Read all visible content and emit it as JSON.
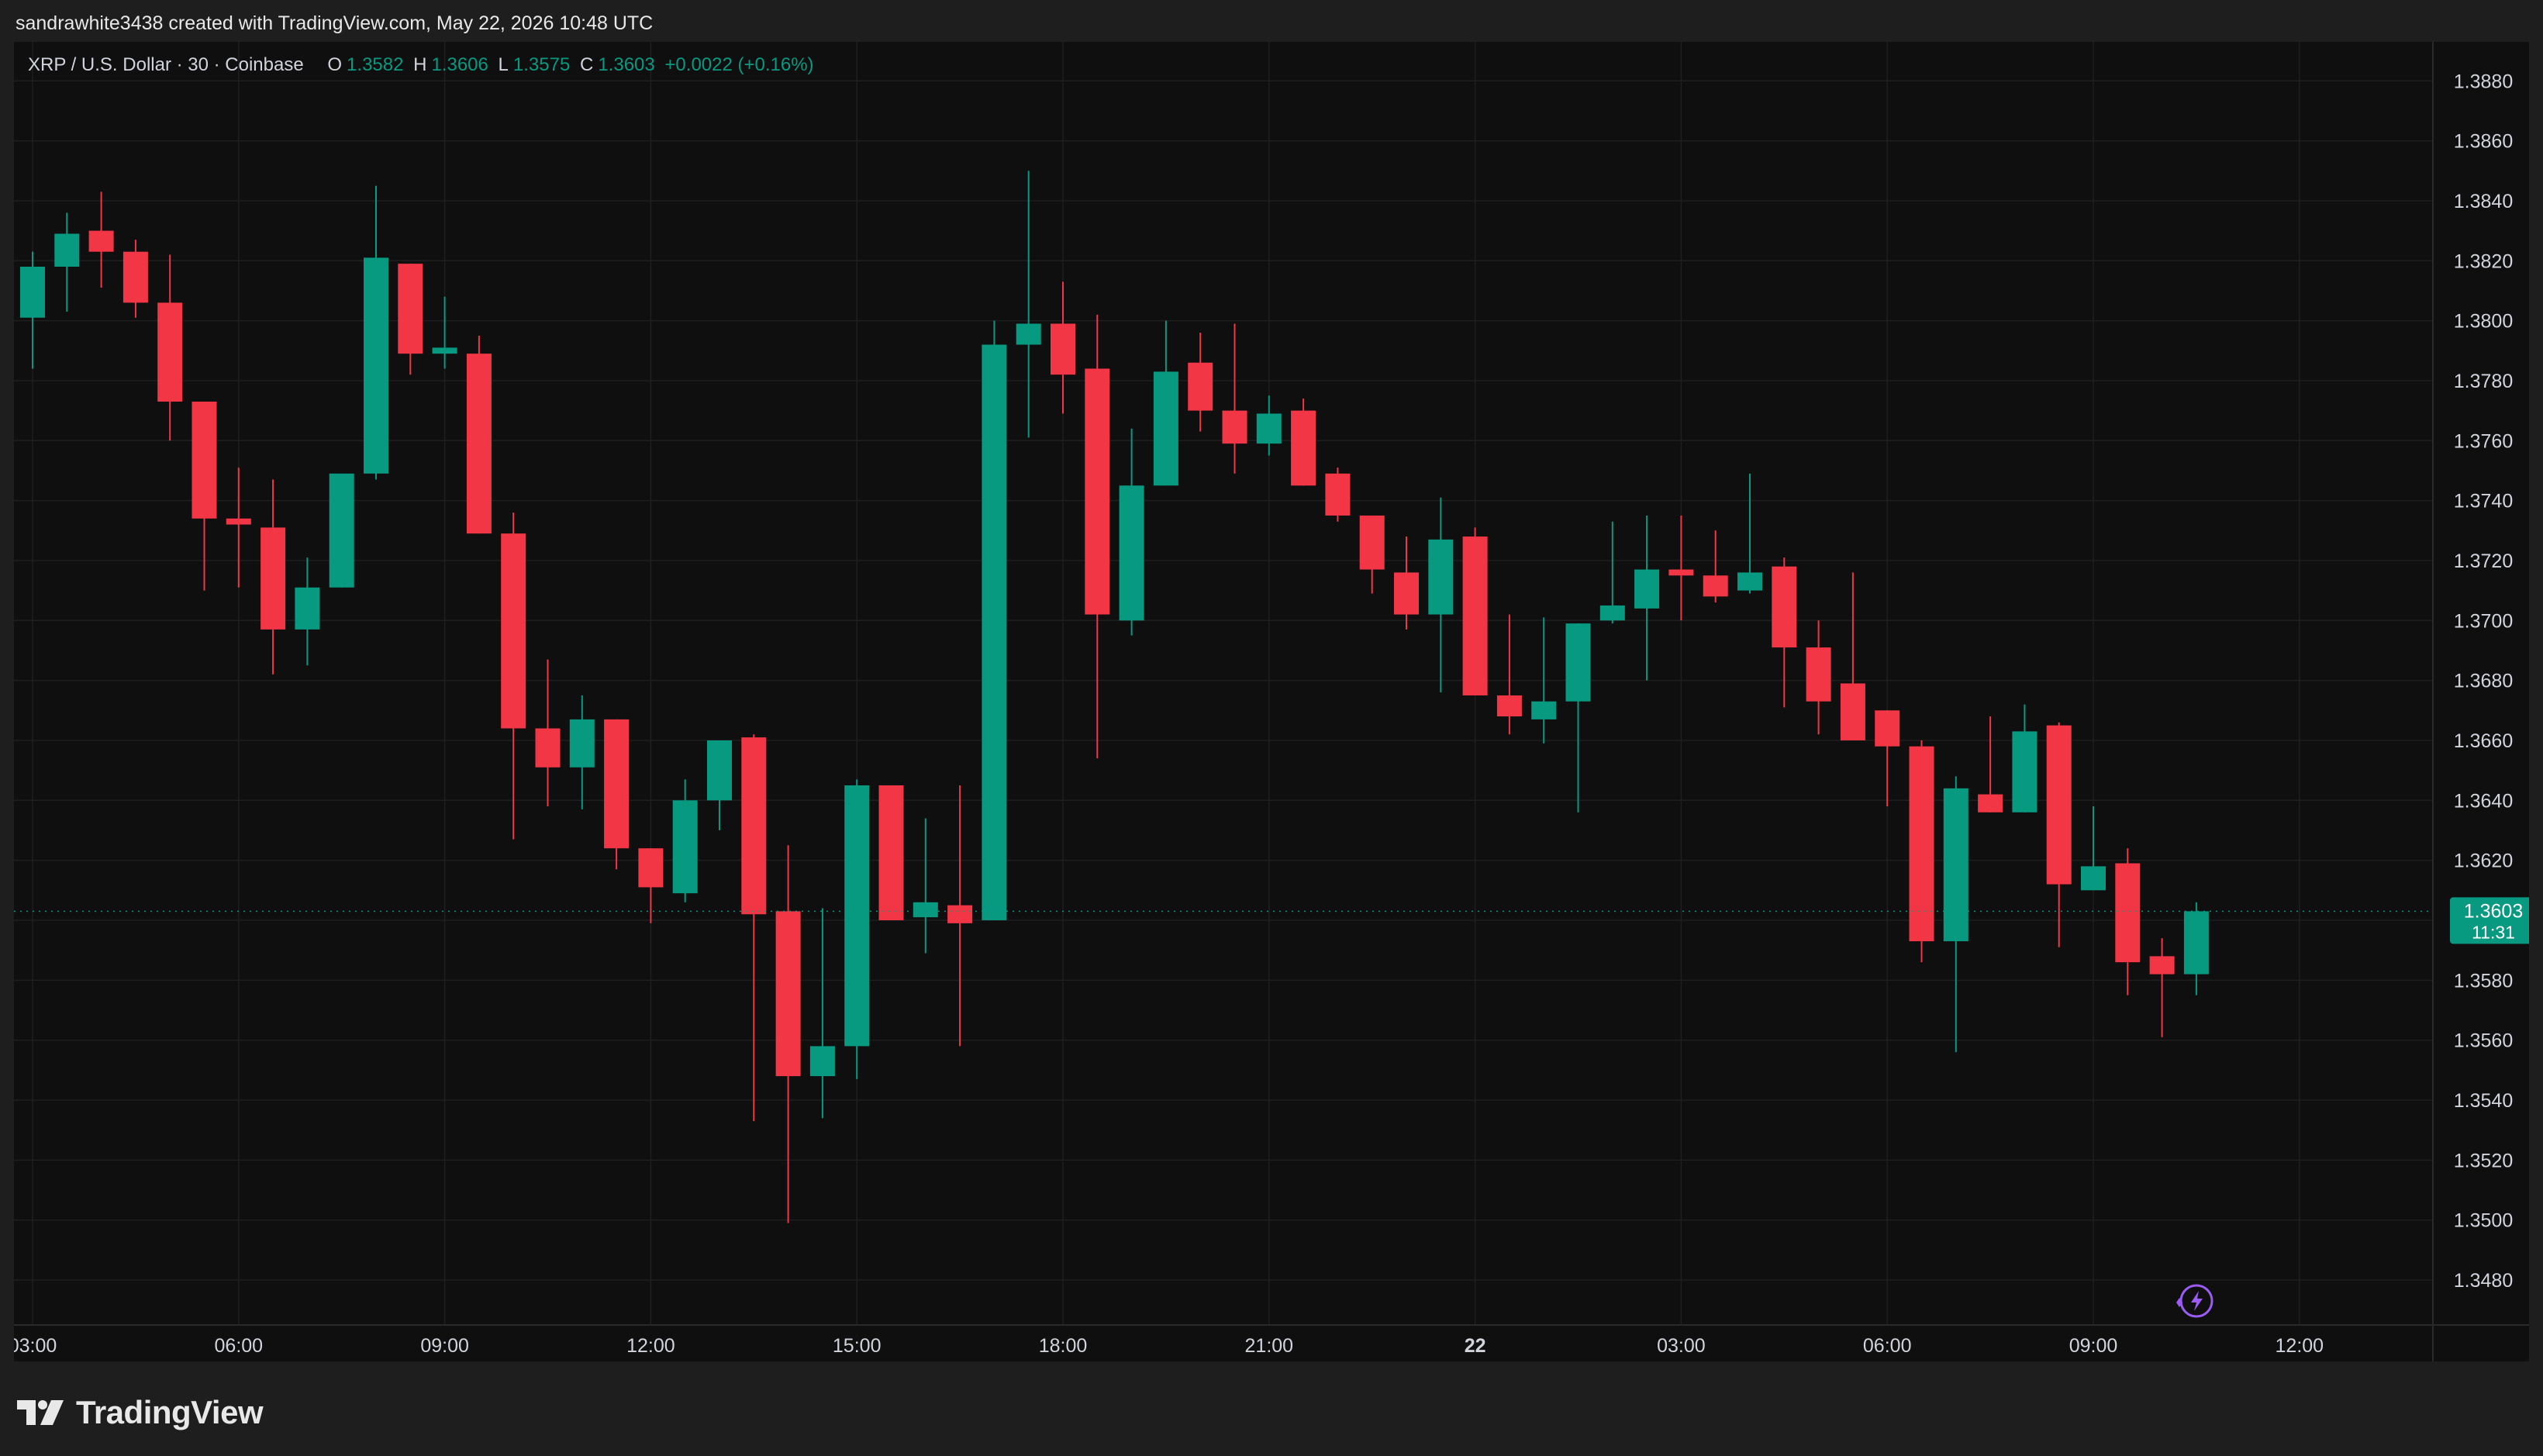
{
  "header": {
    "credit": "sandrawhite3438 created with TradingView.com, May 22, 2026 10:48 UTC"
  },
  "legend": {
    "symbol": "XRP / U.S. Dollar · 30 · Coinbase",
    "o_label": "O",
    "o_value": "1.3582",
    "h_label": "H",
    "h_value": "1.3606",
    "l_label": "L",
    "l_value": "1.3575",
    "c_label": "C",
    "c_value": "1.3603",
    "change": "+0.0022 (+0.16%)"
  },
  "last_price": {
    "price": "1.3603",
    "countdown": "11:31"
  },
  "brand": {
    "name": "TradingView"
  },
  "colors": {
    "up": "#089981",
    "down": "#f23645",
    "background": "#0f0f0f",
    "grid": "#1f1f1f"
  },
  "icons": [
    "tradingview-logo-icon",
    "lightning-icon"
  ],
  "chart_data": {
    "type": "candlestick",
    "ylim": [
      1.3465,
      1.3893
    ],
    "y_ticks": [
      "1.3480",
      "1.3500",
      "1.3520",
      "1.3540",
      "1.3560",
      "1.3580",
      "1.3600",
      "1.3620",
      "1.3640",
      "1.3660",
      "1.3680",
      "1.3700",
      "1.3720",
      "1.3740",
      "1.3760",
      "1.3780",
      "1.3800",
      "1.3820",
      "1.3840",
      "1.3860",
      "1.3880"
    ],
    "x_tick_labels": [
      {
        "label": "03:00",
        "index": 0
      },
      {
        "label": "06:00",
        "index": 6
      },
      {
        "label": "09:00",
        "index": 12
      },
      {
        "label": "12:00",
        "index": 18
      },
      {
        "label": "15:00",
        "index": 24
      },
      {
        "label": "18:00",
        "index": 30
      },
      {
        "label": "21:00",
        "index": 36
      },
      {
        "label": "22",
        "index": 42,
        "bold": true
      },
      {
        "label": "03:00",
        "index": 48
      },
      {
        "label": "06:00",
        "index": 54
      },
      {
        "label": "09:00",
        "index": 60
      },
      {
        "label": "12:00",
        "index": 66
      }
    ],
    "candles": [
      {
        "o": 1.3801,
        "h": 1.3823,
        "l": 1.3784,
        "c": 1.3818
      },
      {
        "o": 1.3818,
        "h": 1.3836,
        "l": 1.3803,
        "c": 1.3829
      },
      {
        "o": 1.383,
        "h": 1.3843,
        "l": 1.3811,
        "c": 1.3823
      },
      {
        "o": 1.3823,
        "h": 1.3827,
        "l": 1.3801,
        "c": 1.3806
      },
      {
        "o": 1.3806,
        "h": 1.3822,
        "l": 1.376,
        "c": 1.3773
      },
      {
        "o": 1.3773,
        "h": 1.3773,
        "l": 1.371,
        "c": 1.3734
      },
      {
        "o": 1.3734,
        "h": 1.3751,
        "l": 1.3711,
        "c": 1.3732
      },
      {
        "o": 1.3731,
        "h": 1.3747,
        "l": 1.3682,
        "c": 1.3697
      },
      {
        "o": 1.3697,
        "h": 1.3721,
        "l": 1.3685,
        "c": 1.3711
      },
      {
        "o": 1.3711,
        "h": 1.3724,
        "l": 1.3711,
        "c": 1.3749
      },
      {
        "o": 1.3749,
        "h": 1.3845,
        "l": 1.3747,
        "c": 1.3821
      },
      {
        "o": 1.3819,
        "h": 1.3819,
        "l": 1.3782,
        "c": 1.3789
      },
      {
        "o": 1.3789,
        "h": 1.3808,
        "l": 1.3784,
        "c": 1.3791
      },
      {
        "o": 1.3789,
        "h": 1.3795,
        "l": 1.3729,
        "c": 1.3729
      },
      {
        "o": 1.3729,
        "h": 1.3736,
        "l": 1.3627,
        "c": 1.3664
      },
      {
        "o": 1.3664,
        "h": 1.3687,
        "l": 1.3638,
        "c": 1.3651
      },
      {
        "o": 1.3651,
        "h": 1.3675,
        "l": 1.3637,
        "c": 1.3667
      },
      {
        "o": 1.3667,
        "h": 1.3667,
        "l": 1.3617,
        "c": 1.3624
      },
      {
        "o": 1.3624,
        "h": 1.3624,
        "l": 1.3599,
        "c": 1.3611
      },
      {
        "o": 1.3609,
        "h": 1.3647,
        "l": 1.3606,
        "c": 1.364
      },
      {
        "o": 1.364,
        "h": 1.366,
        "l": 1.363,
        "c": 1.366
      },
      {
        "o": 1.3661,
        "h": 1.3662,
        "l": 1.3533,
        "c": 1.3602
      },
      {
        "o": 1.3603,
        "h": 1.3625,
        "l": 1.3499,
        "c": 1.3548
      },
      {
        "o": 1.3548,
        "h": 1.3604,
        "l": 1.3534,
        "c": 1.3558
      },
      {
        "o": 1.3558,
        "h": 1.3647,
        "l": 1.3547,
        "c": 1.3645
      },
      {
        "o": 1.3645,
        "h": 1.3645,
        "l": 1.36,
        "c": 1.36
      },
      {
        "o": 1.3601,
        "h": 1.3634,
        "l": 1.3589,
        "c": 1.3606
      },
      {
        "o": 1.3605,
        "h": 1.3645,
        "l": 1.3558,
        "c": 1.3599
      },
      {
        "o": 1.36,
        "h": 1.38,
        "l": 1.36,
        "c": 1.3792
      },
      {
        "o": 1.3792,
        "h": 1.385,
        "l": 1.3761,
        "c": 1.3799
      },
      {
        "o": 1.3799,
        "h": 1.3813,
        "l": 1.3769,
        "c": 1.3782
      },
      {
        "o": 1.3784,
        "h": 1.3802,
        "l": 1.3654,
        "c": 1.3702
      },
      {
        "o": 1.37,
        "h": 1.3764,
        "l": 1.3695,
        "c": 1.3745
      },
      {
        "o": 1.3745,
        "h": 1.38,
        "l": 1.3745,
        "c": 1.3783
      },
      {
        "o": 1.3786,
        "h": 1.3796,
        "l": 1.3763,
        "c": 1.377
      },
      {
        "o": 1.377,
        "h": 1.3799,
        "l": 1.3749,
        "c": 1.3759
      },
      {
        "o": 1.3759,
        "h": 1.3775,
        "l": 1.3755,
        "c": 1.3769
      },
      {
        "o": 1.377,
        "h": 1.3774,
        "l": 1.3745,
        "c": 1.3745
      },
      {
        "o": 1.3749,
        "h": 1.3751,
        "l": 1.3733,
        "c": 1.3735
      },
      {
        "o": 1.3735,
        "h": 1.3735,
        "l": 1.3709,
        "c": 1.3717
      },
      {
        "o": 1.3716,
        "h": 1.3728,
        "l": 1.3697,
        "c": 1.3702
      },
      {
        "o": 1.3702,
        "h": 1.3741,
        "l": 1.3676,
        "c": 1.3727
      },
      {
        "o": 1.3728,
        "h": 1.3731,
        "l": 1.3675,
        "c": 1.3675
      },
      {
        "o": 1.3675,
        "h": 1.3702,
        "l": 1.3662,
        "c": 1.3668
      },
      {
        "o": 1.3667,
        "h": 1.3701,
        "l": 1.3659,
        "c": 1.3673
      },
      {
        "o": 1.3673,
        "h": 1.3699,
        "l": 1.3636,
        "c": 1.3699
      },
      {
        "o": 1.37,
        "h": 1.3733,
        "l": 1.3699,
        "c": 1.3705
      },
      {
        "o": 1.3704,
        "h": 1.3735,
        "l": 1.368,
        "c": 1.3717
      },
      {
        "o": 1.3717,
        "h": 1.3735,
        "l": 1.37,
        "c": 1.3715
      },
      {
        "o": 1.3715,
        "h": 1.373,
        "l": 1.3706,
        "c": 1.3708
      },
      {
        "o": 1.371,
        "h": 1.3749,
        "l": 1.3709,
        "c": 1.3716
      },
      {
        "o": 1.3718,
        "h": 1.3721,
        "l": 1.3671,
        "c": 1.3691
      },
      {
        "o": 1.3691,
        "h": 1.37,
        "l": 1.3662,
        "c": 1.3673
      },
      {
        "o": 1.3679,
        "h": 1.3716,
        "l": 1.3661,
        "c": 1.366
      },
      {
        "o": 1.367,
        "h": 1.367,
        "l": 1.3638,
        "c": 1.3658
      },
      {
        "o": 1.3658,
        "h": 1.366,
        "l": 1.3586,
        "c": 1.3593
      },
      {
        "o": 1.3593,
        "h": 1.3648,
        "l": 1.3556,
        "c": 1.3644
      },
      {
        "o": 1.3642,
        "h": 1.3668,
        "l": 1.3636,
        "c": 1.3636
      },
      {
        "o": 1.3636,
        "h": 1.3672,
        "l": 1.3636,
        "c": 1.3663
      },
      {
        "o": 1.3665,
        "h": 1.3666,
        "l": 1.3591,
        "c": 1.3612
      },
      {
        "o": 1.361,
        "h": 1.3638,
        "l": 1.361,
        "c": 1.3618
      },
      {
        "o": 1.3619,
        "h": 1.3624,
        "l": 1.3575,
        "c": 1.3586
      },
      {
        "o": 1.3588,
        "h": 1.3594,
        "l": 1.3561,
        "c": 1.3582
      },
      {
        "o": 1.3582,
        "h": 1.3606,
        "l": 1.3575,
        "c": 1.3603
      }
    ]
  }
}
